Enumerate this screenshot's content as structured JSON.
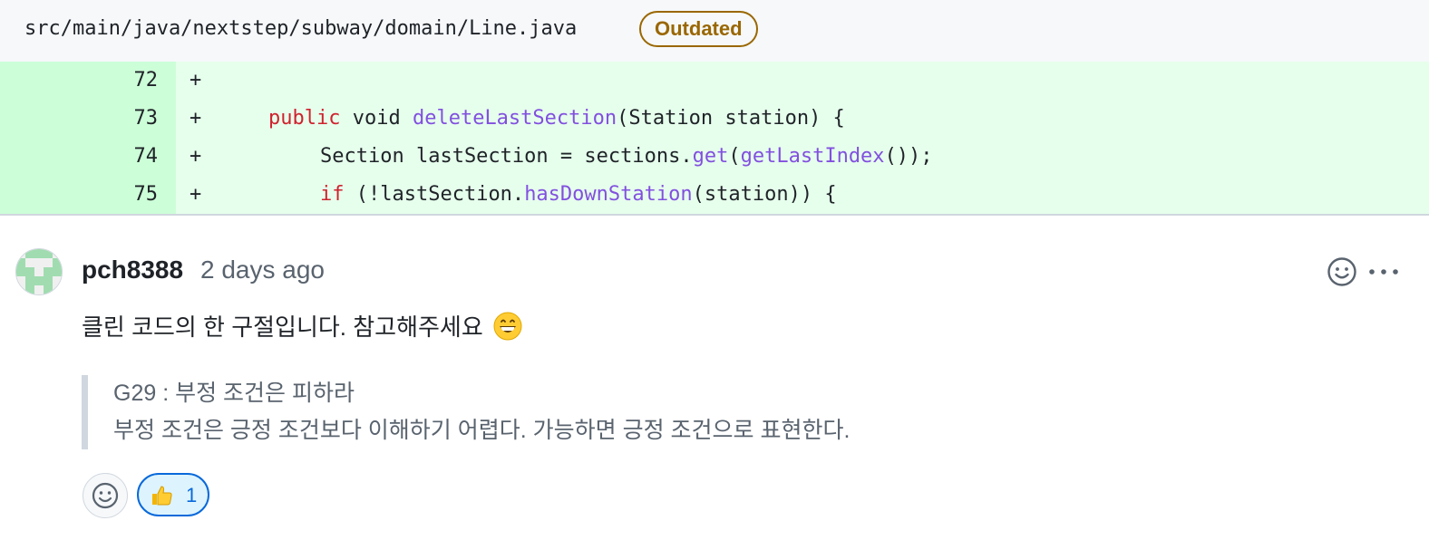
{
  "file": {
    "path": "src/main/java/nextstep/subway/domain/Line.java",
    "badge": "Outdated"
  },
  "diff": {
    "lines": [
      {
        "num": "72",
        "marker": "+"
      },
      {
        "num": "73",
        "marker": "+"
      },
      {
        "num": "74",
        "marker": "+"
      },
      {
        "num": "75",
        "marker": "+"
      }
    ],
    "code": {
      "line73": {
        "keyword": "public",
        "type": "void",
        "method": "deleteLastSection",
        "params": "(Station station) {"
      },
      "line74": {
        "decl": "Section lastSection = sections.",
        "call1": "get",
        "paren": "(",
        "call2": "getLastIndex",
        "tail": "());"
      },
      "line75": {
        "keyword": "if",
        "pre": " (!lastSection.",
        "call": "hasDownStation",
        "tail": "(station)) {"
      }
    }
  },
  "comment": {
    "author": "pch8388",
    "time": "2 days ago",
    "body": "클린 코드의 한 구절입니다. 참고해주세요",
    "body_emoji": "grinning-face-emoji",
    "quote": [
      "G29 : 부정 조건은 피하라",
      "부정 조건은 긍정 조건보다 이해하기 어렵다. 가능하면 긍정 조건으로 표현한다."
    ],
    "reactions": [
      {
        "emoji": "thumbs-up",
        "count": "1"
      }
    ]
  },
  "colors": {
    "diff_add_bg": "#e6ffec",
    "diff_add_gutter": "#ccffd8",
    "keyword": "#cf222e",
    "function": "#8250df",
    "badge": "#9a6700",
    "reaction_accent": "#0969da"
  }
}
